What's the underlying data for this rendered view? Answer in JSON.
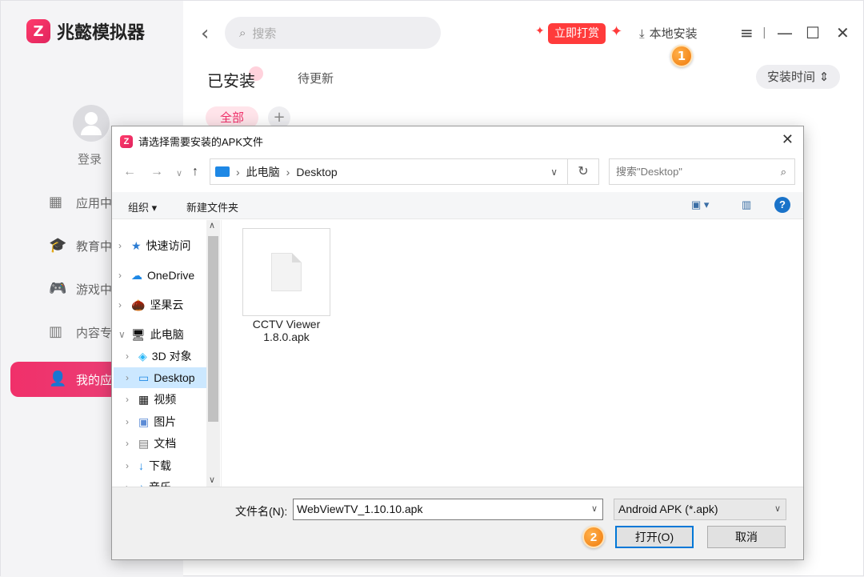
{
  "app": {
    "logo_mark": "Z",
    "name": "兆懿模拟器",
    "login": "登录",
    "nav": [
      "应用中",
      "教育中",
      "游戏中",
      "内容专",
      "我的应"
    ],
    "search_placeholder": "搜索",
    "promo": "立即打赏",
    "local_install": "本地安装",
    "tabs": {
      "installed": "已安装",
      "update": "待更新"
    },
    "sort": "安装时间 ⇕",
    "chip_all": "全部",
    "chip_add": "+",
    "badges": [
      "1",
      "2"
    ],
    "accent": "#f0306a"
  },
  "dialog": {
    "title": "请选择需要安装的APK文件",
    "path": [
      "此电脑",
      "Desktop"
    ],
    "search_placeholder": "搜索\"Desktop\"",
    "toolbar": {
      "organize": "组织 ▾",
      "new_folder": "新建文件夹"
    },
    "tree": [
      {
        "label": "快速访问",
        "icon": "★"
      },
      {
        "label": "OneDrive",
        "icon": "☁"
      },
      {
        "label": "坚果云",
        "icon": "🌰"
      },
      {
        "label": "此电脑",
        "icon": "🖥"
      },
      {
        "label": "3D 对象",
        "icon": "◈"
      },
      {
        "label": "Desktop",
        "icon": "▭"
      },
      {
        "label": "视频",
        "icon": "▦"
      },
      {
        "label": "图片",
        "icon": "▣"
      },
      {
        "label": "文档",
        "icon": "▤"
      },
      {
        "label": "下载",
        "icon": "↓"
      },
      {
        "label": "音乐",
        "icon": "♪"
      }
    ],
    "file": {
      "name_line1": "CCTV Viewer",
      "name_line2": "1.8.0.apk"
    },
    "filename_label": "文件名(N):",
    "filename_value": "WebViewTV_1.10.10.apk",
    "filetype": "Android APK (*.apk)",
    "open": "打开(O)",
    "cancel": "取消"
  }
}
